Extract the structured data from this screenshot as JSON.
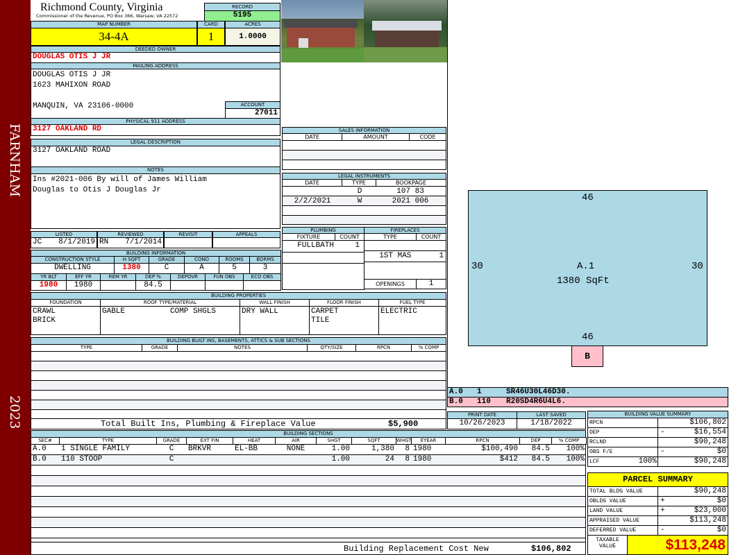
{
  "sidebar": {
    "town": "FARNHAM",
    "year": "2023"
  },
  "header": {
    "county": "Richmond County, Virginia",
    "subtitle": "Commissioner of the Revenue, PO Box 366, Warsaw, VA 22572",
    "record_label": "RECORD",
    "record": "5195",
    "map_label": "MAP NUMBER",
    "map": "34-4A",
    "card_label": "CARD",
    "card": "1",
    "acres_label": "ACRES",
    "acres": "1.0000"
  },
  "owner": {
    "label": "DEEDED OWNER",
    "name": "DOUGLAS OTIS J JR"
  },
  "mailing": {
    "label": "MAILING ADDRESS",
    "line1": "DOUGLAS OTIS J JR",
    "line2": "1623 MAHIXON ROAD",
    "line3": "MANQUIN, VA 23106-0000",
    "account_label": "ACCOUNT",
    "account": "27011"
  },
  "physical": {
    "label": "PHYSICAL 911 ADDRESS",
    "value": "3127 OAKLAND RD"
  },
  "legal": {
    "label": "LEGAL DESCRIPTION",
    "value": "3127 OAKLAND ROAD"
  },
  "notes": {
    "label": "NOTES",
    "line1": "Ins #2021-006 By will of James William",
    "line2": "Douglas to Otis J Douglas Jr"
  },
  "review": {
    "headers": [
      "LISTED",
      "REVIEWED",
      "REVISIT",
      "APPEALS"
    ],
    "listed_by": "JC",
    "listed": "8/1/2019",
    "reviewed_by": "RN",
    "reviewed": "7/1/2014"
  },
  "building_info": {
    "label": "BUILDING INFORMATION",
    "headers1": [
      "CONSTRUCTION STYLE",
      "H SQFT",
      "GRADE",
      "COND",
      "ROOMS",
      "BDRMS"
    ],
    "values1": [
      "DWELLING",
      "1380",
      "C",
      "A",
      "5",
      "3"
    ],
    "headers2": [
      "YR BLT",
      "EFF YR",
      "REM YR",
      "DEP %",
      "DEPOVR",
      "FUN OBS",
      "ECO OBS"
    ],
    "values2": [
      "1980",
      "1980",
      "",
      "84.5",
      "",
      "",
      ""
    ]
  },
  "sales": {
    "label": "SALES INFORMATION",
    "headers": [
      "DATE",
      "AMOUNT",
      "CODE"
    ]
  },
  "legal_instruments": {
    "label": "LEGAL INSTRUMENTS",
    "headers": [
      "DATE",
      "TYPE",
      "BOOKPAGE"
    ],
    "rows": [
      {
        "date": "",
        "type": "D",
        "book": "107 83"
      },
      {
        "date": "2/2/2021",
        "type": "W",
        "book": "2021 006"
      }
    ]
  },
  "plumbing": {
    "label": "PLUMBING",
    "headers": [
      "FIXTURE",
      "COUNT"
    ],
    "fixture": "FULLBATH",
    "count": "1"
  },
  "fireplaces": {
    "label": "FIREPLACES",
    "headers": [
      "TYPE",
      "COUNT"
    ],
    "type": "1ST MAS",
    "count": "1",
    "openings_label": "OPENINGS",
    "openings": "1"
  },
  "properties": {
    "label": "BUILDING PROPERTIES",
    "headers": [
      "FOUNDATION",
      "ROOF TYPE/MATERIAL",
      "WALL FINISH",
      "FLOOR FINISH",
      "FUEL TYPE"
    ],
    "foundation": "CRAWL\nBRICK",
    "roof_type": "GABLE",
    "roof_material": "COMP SHGLS",
    "wall": "DRY WALL",
    "floor": "CARPET\nTILE",
    "fuel": "ELECTRIC"
  },
  "builtins": {
    "label": "BUILDING BUILT INS, BASEMENTS, ATTICS & SUB SECTIONS",
    "headers": [
      "TYPE",
      "GRADE",
      "NOTES",
      "QTY/SIZE",
      "RPCN",
      "% COMP"
    ],
    "total_label": "Total Built Ins, Plumbing & Fireplace Value",
    "total": "$5,900"
  },
  "dates": {
    "print_label": "PRINT DATE",
    "print": "10/26/2023",
    "saved_label": "LAST SAVED",
    "saved": "1/18/2022"
  },
  "sketch": {
    "area_label": "A.1",
    "sqft": "1380 SqFt",
    "top": "46",
    "bottom": "46",
    "left": "30",
    "right": "30",
    "b_label": "B",
    "codes": [
      {
        "sec": "A.0",
        "code": "1",
        "vector": "SR46U30L46D30."
      },
      {
        "sec": "B.0",
        "code": "110",
        "vector": "R20SD4R6U4L6."
      }
    ]
  },
  "sections": {
    "label": "BUILDING SECTIONS",
    "headers": [
      "SEC#",
      "TYPE",
      "GRADE",
      "EXT FIN",
      "HEAT",
      "AIR",
      "SHGT",
      "SQFT",
      "WHGT",
      "EYEAR",
      "RPCN",
      "DEP",
      "% COMP"
    ],
    "rows": [
      [
        "A.0",
        "1 SINGLE FAMILY",
        "C",
        "BRKVR",
        "EL-BB",
        "NONE",
        "1.00",
        "1,380",
        "8",
        "1980",
        "$100,490",
        "84.5",
        "100%"
      ],
      [
        "B.0",
        "110 STOOP",
        "C",
        "",
        "",
        "",
        "1.00",
        "24",
        "8",
        "1980",
        "$412",
        "84.5",
        "100%"
      ]
    ],
    "total_label": "Building Replacement Cost New",
    "total": "$106,802"
  },
  "value_summary": {
    "label": "BUILDING VALUE SUMMARY",
    "rows": [
      {
        "k": "RPCN",
        "s": "",
        "v": "$106,802"
      },
      {
        "k": "DEP",
        "s": "-",
        "v": "$16,554"
      },
      {
        "k": "RCLND",
        "s": "",
        "v": "$90,248"
      },
      {
        "k": "OBS F/E",
        "s": "-",
        "v": "$0"
      },
      {
        "k": "LCF",
        "p": "100%",
        "s": "",
        "v": "$90,248"
      }
    ]
  },
  "parcel": {
    "label": "PARCEL SUMMARY",
    "rows": [
      {
        "k": "TOTAL BLDG VALUE",
        "s": "",
        "v": "$90,248"
      },
      {
        "k": "OBLDG VALUE",
        "s": "+",
        "v": "$0"
      },
      {
        "k": "LAND VALUE",
        "s": "+",
        "v": "$23,000"
      },
      {
        "k": "APPRAISED VALUE",
        "s": "",
        "v": "$113,248"
      },
      {
        "k": "DEFERRED VALUE",
        "s": "-",
        "v": "$0"
      }
    ],
    "taxable_label": "TAXABLE VALUE",
    "taxable": "$113,248"
  },
  "colors": {
    "header": "#add8e6",
    "sidebar": "#7f0000",
    "highlight": "#ffff00",
    "record": "#90ee90",
    "red": "#e00000",
    "pink": "#ffc0cb"
  }
}
